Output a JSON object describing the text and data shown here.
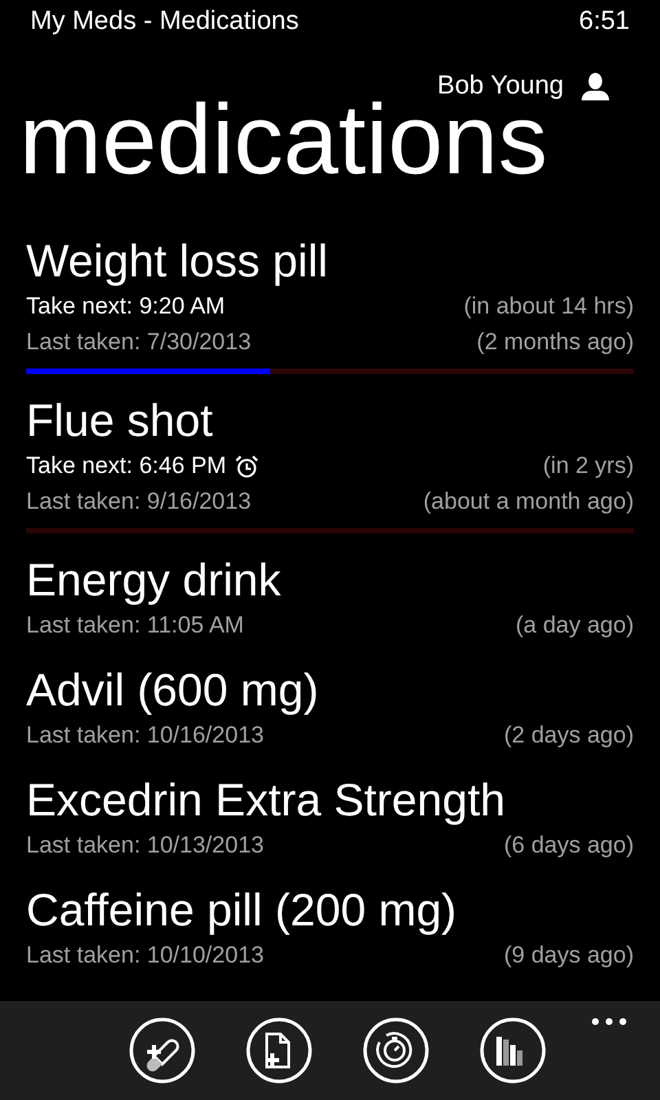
{
  "status_bar": {
    "app_title": "My Meds - Medications",
    "time": "6:51"
  },
  "user": {
    "name": "Bob Young"
  },
  "page_title": "medications",
  "medications": [
    {
      "name": "Weight loss pill",
      "take_next": "Take next: 9:20 AM",
      "alarm": false,
      "next_relative": "(in about 14 hrs)",
      "last_taken": "Last taken: 7/30/2013",
      "last_relative": "(2 months ago)",
      "level": 0.4
    },
    {
      "name": "Flue shot",
      "take_next": "Take next: 6:46 PM",
      "alarm": true,
      "next_relative": "(in 2 yrs)",
      "last_taken": "Last taken: 9/16/2013",
      "last_relative": "(about a month ago)",
      "level": 0
    },
    {
      "name": "Energy drink",
      "last_taken": "Last taken: 11:05 AM",
      "last_relative": "(a day ago)"
    },
    {
      "name": "Advil (600 mg)",
      "last_taken": "Last taken: 10/16/2013",
      "last_relative": "(2 days ago)"
    },
    {
      "name": "Excedrin Extra Strength",
      "last_taken": "Last taken: 10/13/2013",
      "last_relative": "(6 days ago)"
    },
    {
      "name": "Caffeine pill (200 mg)",
      "last_taken": "Last taken: 10/10/2013",
      "last_relative": "(9 days ago)"
    }
  ],
  "app_bar": {
    "buttons": [
      {
        "kind": "add-pill"
      },
      {
        "kind": "add-page"
      },
      {
        "kind": "timer"
      },
      {
        "kind": "chart"
      }
    ]
  }
}
